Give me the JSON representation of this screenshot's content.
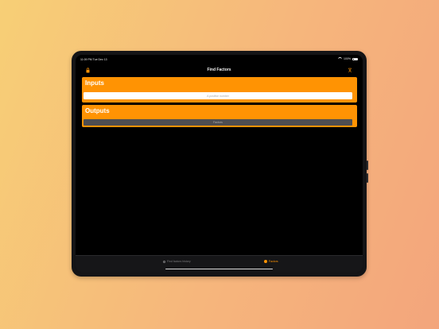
{
  "status_bar": {
    "time": "11:09 PM   Tue Dec 13",
    "battery": "100%"
  },
  "nav": {
    "title": "Find Factors",
    "left_icon": "lock-icon",
    "right_icon": "share-icon"
  },
  "inputs": {
    "title": "Inputs",
    "number_placeholder": "A positive number"
  },
  "outputs": {
    "title": "Outputs",
    "result_placeholder": "Factors"
  },
  "tabs": [
    {
      "label": "Find factors history",
      "icon": "clock-icon",
      "selected": false
    },
    {
      "label": "Factors",
      "icon": "factor-icon",
      "selected": true
    }
  ],
  "colors": {
    "accent": "#ff9303",
    "screen_bg": "#000000",
    "tab_bar_bg": "#161618"
  }
}
